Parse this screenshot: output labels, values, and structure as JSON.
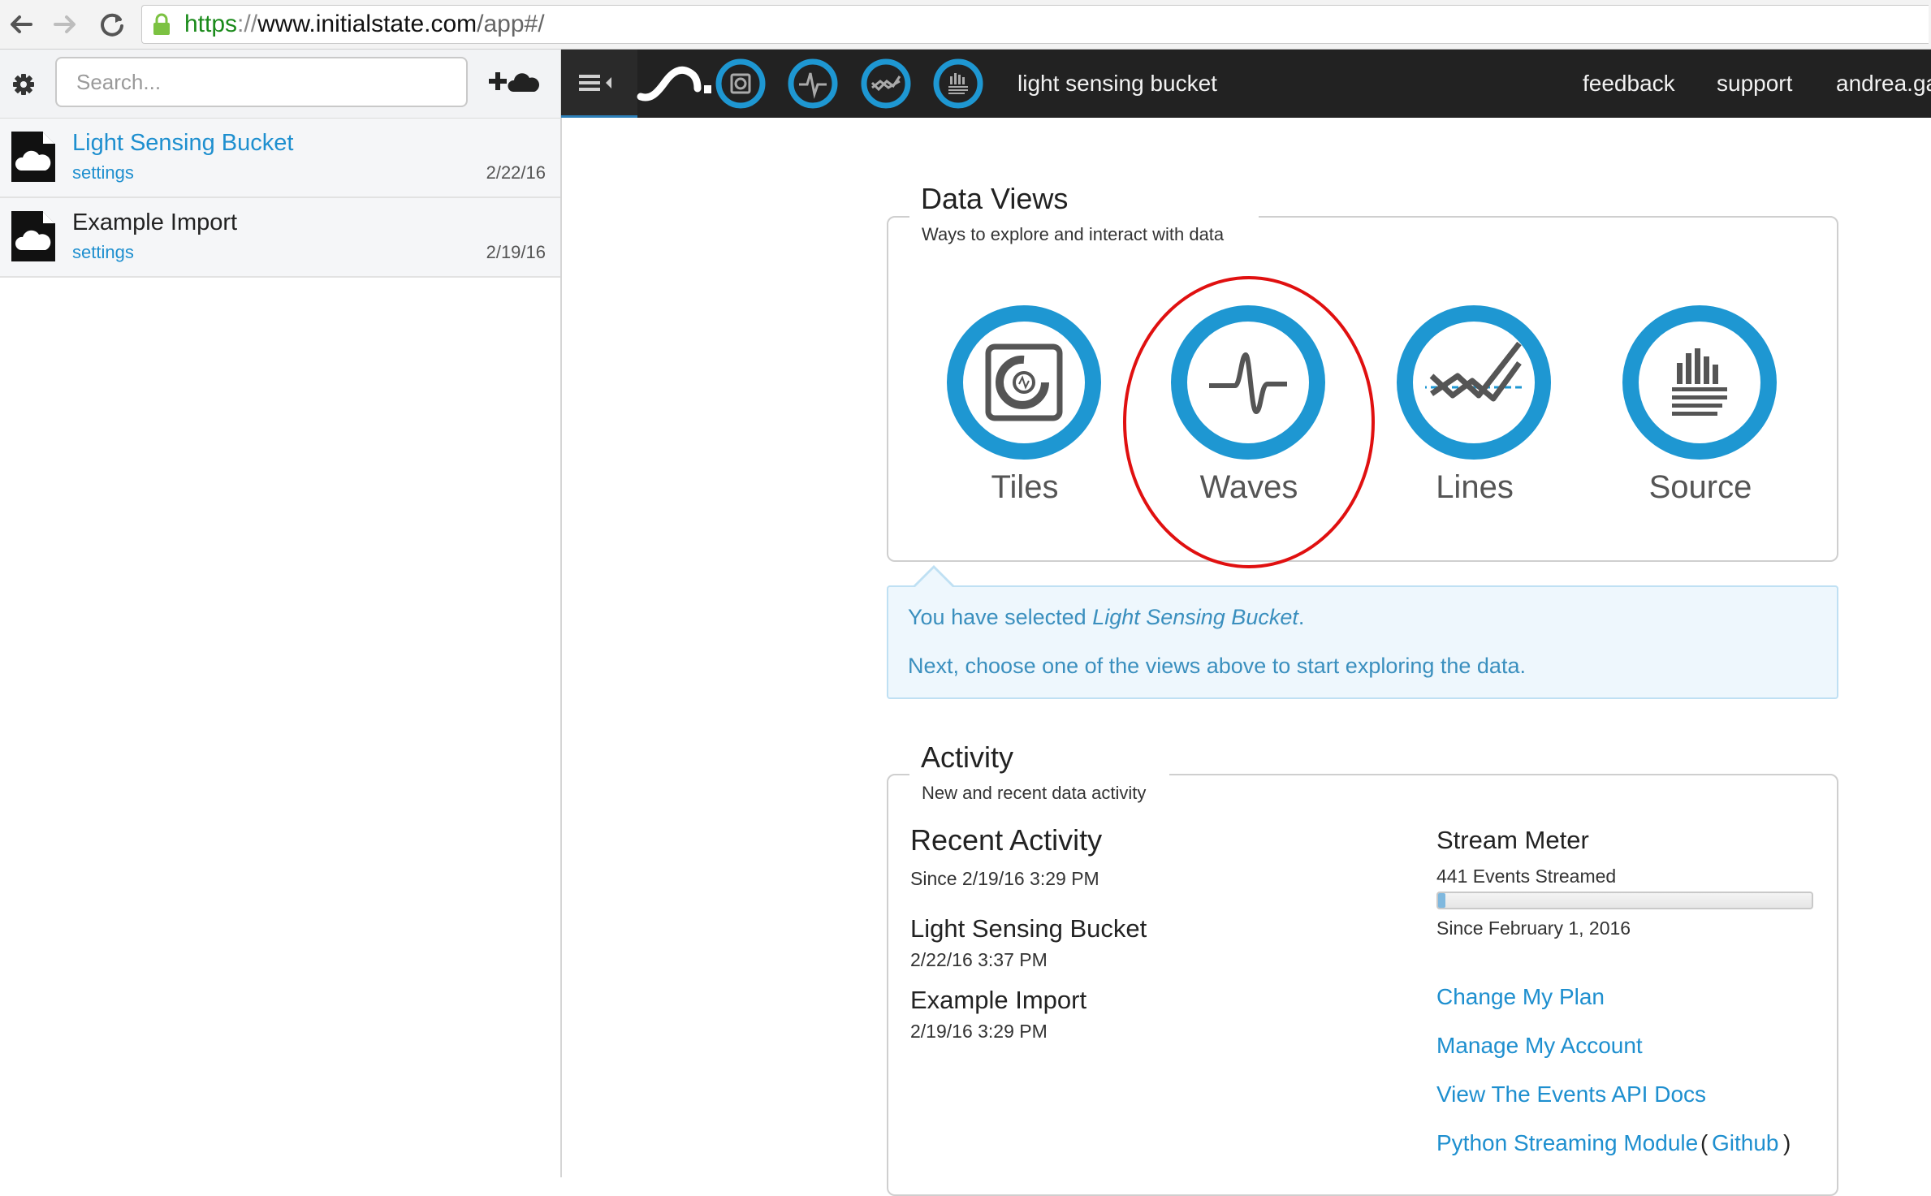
{
  "browser": {
    "url_protocol": "https",
    "url_separator": "://",
    "url_host": "www.initialstate.com",
    "url_path": "/app#/"
  },
  "sidebar": {
    "search_placeholder": "Search...",
    "buckets": [
      {
        "name": "Light Sensing Bucket",
        "settings_label": "settings",
        "date": "2/22/16",
        "active": true
      },
      {
        "name": "Example Import",
        "settings_label": "settings",
        "date": "2/19/16",
        "active": false
      }
    ]
  },
  "topbar": {
    "bucket_title": "light sensing bucket",
    "links": [
      "feedback",
      "support",
      "andrea.ga"
    ]
  },
  "data_views": {
    "title": "Data Views",
    "subtitle": "Ways to explore and interact with data",
    "views": [
      {
        "label": "Tiles",
        "icon": "tiles-icon"
      },
      {
        "label": "Waves",
        "icon": "waves-icon"
      },
      {
        "label": "Lines",
        "icon": "lines-icon"
      },
      {
        "label": "Source",
        "icon": "source-icon"
      }
    ],
    "highlighted": "Waves"
  },
  "selection_info": {
    "prefix": "You have selected ",
    "bucket": "Light Sensing Bucket",
    "suffix": ".",
    "next": "Next, choose one of the views above to start exploring the data."
  },
  "activity": {
    "title": "Activity",
    "subtitle": "New and recent data activity",
    "recent_heading": "Recent Activity",
    "since": "Since 2/19/16 3:29 PM",
    "items": [
      {
        "name": "Light Sensing Bucket",
        "time": "2/22/16 3:37 PM"
      },
      {
        "name": "Example Import",
        "time": "2/19/16 3:29 PM"
      }
    ],
    "meter_heading": "Stream Meter",
    "events_streamed": "441 Events Streamed",
    "meter_fraction": 0.02,
    "meter_since": "Since February 1, 2016",
    "links": [
      "Change My Plan",
      "Manage My Account",
      "View The Events API Docs"
    ],
    "python_link": "Python Streaming Module",
    "paren_open": "(",
    "github_link": "Github",
    "paren_close": ")"
  },
  "colors": {
    "accent_blue": "#1e97d2",
    "link_blue": "#1e8fcf",
    "topbar_bg": "#222222",
    "highlight_red": "#e01010"
  }
}
